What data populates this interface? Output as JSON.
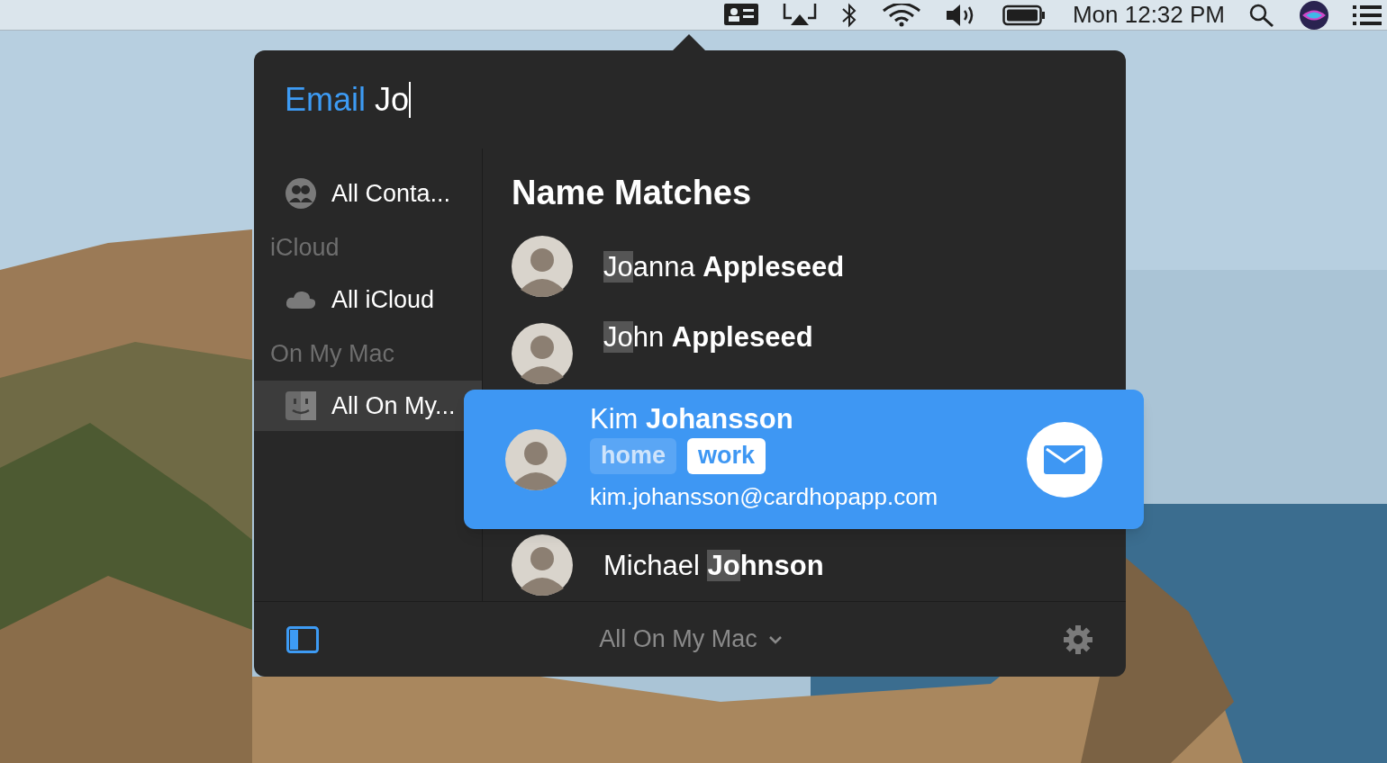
{
  "menu_bar": {
    "icons": [
      {
        "kind": "contacts"
      },
      {
        "kind": "airplay"
      },
      {
        "kind": "bluetooth"
      },
      {
        "kind": "wifi"
      },
      {
        "kind": "volume"
      },
      {
        "kind": "battery"
      }
    ],
    "clock": "Mon 12:32 PM",
    "right_icons": [
      {
        "kind": "search"
      },
      {
        "kind": "siri"
      },
      {
        "kind": "list"
      }
    ]
  },
  "popover": {
    "search": {
      "prefix": "Email",
      "value": "Jo"
    },
    "sidebar": [
      {
        "kind": "people",
        "label": "All Conta...",
        "selected": false
      },
      {
        "kind": "section",
        "label": "iCloud"
      },
      {
        "kind": "cloud",
        "label": "All iCloud",
        "selected": false
      },
      {
        "kind": "section",
        "label": "On My Mac"
      },
      {
        "kind": "finder",
        "label": "All On My...",
        "selected": true
      }
    ],
    "heading": "Name Matches",
    "contacts": [
      {
        "name": [
          {
            "text": "Jo",
            "bold": false,
            "match": true
          },
          {
            "text": "anna ",
            "bold": false,
            "match": false
          },
          {
            "text": "Appleseed",
            "bold": true,
            "match": false
          }
        ],
        "selected": false
      },
      {
        "name": [
          {
            "text": "Jo",
            "bold": false,
            "match": true
          },
          {
            "text": "hn ",
            "bold": false,
            "match": false
          },
          {
            "text": "Appleseed",
            "bold": true,
            "match": false
          }
        ],
        "selected": false
      },
      {
        "name": [
          {
            "text": "Kim ",
            "bold": false,
            "match": false
          },
          {
            "text": "Johansson",
            "bold": true,
            "match": false
          }
        ],
        "selected": true,
        "tags": [
          {
            "label": "home",
            "selected": false
          },
          {
            "label": "work",
            "selected": true
          }
        ],
        "email": "kim.johansson@cardhopapp.com"
      },
      {
        "name": [
          {
            "text": "Michael ",
            "bold": false,
            "match": false
          },
          {
            "text": "Jo",
            "bold": true,
            "match": true
          },
          {
            "text": "hnson",
            "bold": true,
            "match": false
          }
        ],
        "selected": false
      }
    ],
    "footer": {
      "scope": "All On My Mac"
    }
  }
}
